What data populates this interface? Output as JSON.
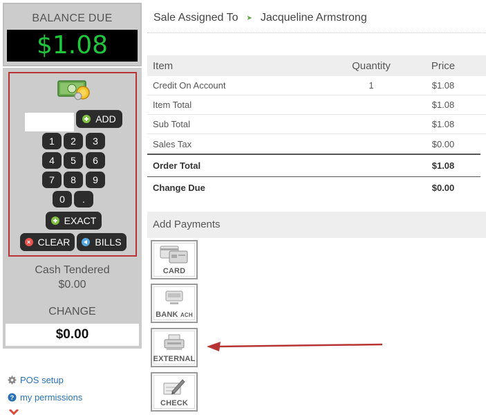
{
  "balance": {
    "label": "BALANCE DUE",
    "amount": "$1.08"
  },
  "keypad": {
    "add_label": "ADD",
    "keys": [
      "1",
      "2",
      "3",
      "4",
      "5",
      "6",
      "7",
      "8",
      "9",
      "0",
      "."
    ],
    "exact_label": "EXACT",
    "clear_label": "CLEAR",
    "bills_label": "BILLS",
    "amount_value": ""
  },
  "tender": {
    "cash_label": "Cash Tendered",
    "cash_value": "$0.00",
    "change_label": "CHANGE",
    "change_value": "$0.00"
  },
  "side_links": [
    {
      "label": "POS setup",
      "icon": "gear-icon"
    },
    {
      "label": "my permissions",
      "icon": "question-icon"
    }
  ],
  "sale": {
    "assigned_label": "Sale Assigned To",
    "customer": "Jacqueline Armstrong"
  },
  "table": {
    "headers": [
      "Item",
      "Quantity",
      "Price"
    ],
    "rows": [
      {
        "item": "Credit On Account",
        "qty": "1",
        "price": "$1.08"
      },
      {
        "item": "Item Total",
        "qty": "",
        "price": "$1.08"
      },
      {
        "item": "Sub Total",
        "qty": "",
        "price": "$1.08"
      },
      {
        "item": "Sales Tax",
        "qty": "",
        "price": "$0.00"
      }
    ],
    "order_total_label": "Order Total",
    "order_total_value": "$1.08",
    "change_due_label": "Change Due",
    "change_due_value": "$0.00"
  },
  "payments": {
    "title": "Add Payments",
    "buttons": [
      {
        "label": "CARD",
        "icon": "credit-card-icon"
      },
      {
        "label": "BANK",
        "sub": "ACH",
        "icon": "bank-icon"
      },
      {
        "label": "EXTERNAL",
        "icon": "external-terminal-icon"
      },
      {
        "label": "CHECK",
        "icon": "check-pen-icon"
      }
    ]
  },
  "colors": {
    "balance_green": "#1fc83a",
    "annotation_red": "#b83434",
    "link_blue": "#2a72b8",
    "add_green": "#7fc241"
  }
}
